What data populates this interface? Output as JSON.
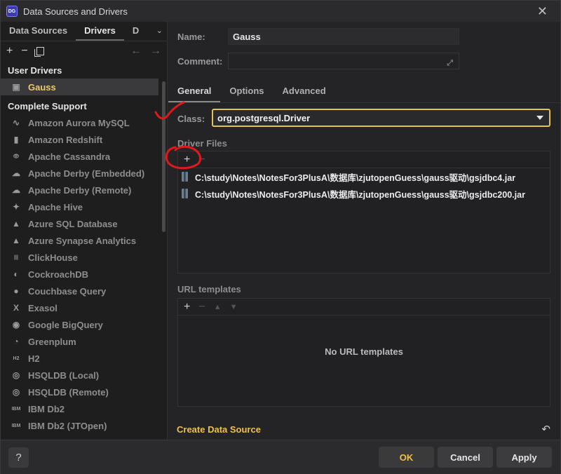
{
  "window": {
    "title": "Data Sources and Drivers",
    "app_icon_text": "DG"
  },
  "left": {
    "tabs": [
      "Data Sources",
      "Drivers",
      "D"
    ],
    "user_drivers_title": "User Drivers",
    "user_drivers": [
      {
        "name": "Gauss",
        "icon": "gauss-icon"
      }
    ],
    "complete_support_title": "Complete Support",
    "drivers": [
      {
        "name": "Amazon Aurora MySQL",
        "icon": "aurora-icon"
      },
      {
        "name": "Amazon Redshift",
        "icon": "redshift-icon"
      },
      {
        "name": "Apache Cassandra",
        "icon": "cassandra-icon"
      },
      {
        "name": "Apache Derby (Embedded)",
        "icon": "derby-icon"
      },
      {
        "name": "Apache Derby (Remote)",
        "icon": "derby-icon"
      },
      {
        "name": "Apache Hive",
        "icon": "hive-icon"
      },
      {
        "name": "Azure SQL Database",
        "icon": "azure-icon"
      },
      {
        "name": "Azure Synapse Analytics",
        "icon": "azure-icon"
      },
      {
        "name": "ClickHouse",
        "icon": "clickhouse-icon"
      },
      {
        "name": "CockroachDB",
        "icon": "cockroach-icon"
      },
      {
        "name": "Couchbase Query",
        "icon": "couchbase-icon"
      },
      {
        "name": "Exasol",
        "icon": "exasol-icon"
      },
      {
        "name": "Google BigQuery",
        "icon": "bigquery-icon"
      },
      {
        "name": "Greenplum",
        "icon": "greenplum-icon"
      },
      {
        "name": "H2",
        "icon": "h2-icon"
      },
      {
        "name": "HSQLDB (Local)",
        "icon": "hsqldb-icon"
      },
      {
        "name": "HSQLDB (Remote)",
        "icon": "hsqldb-icon"
      },
      {
        "name": "IBM Db2",
        "icon": "db2-icon"
      },
      {
        "name": "IBM Db2 (JTOpen)",
        "icon": "db2-icon"
      }
    ]
  },
  "form": {
    "name_label": "Name:",
    "name_value": "Gauss",
    "comment_label": "Comment:",
    "comment_value": "",
    "tabs": [
      "General",
      "Options",
      "Advanced"
    ],
    "class_label": "Class:",
    "class_value": "org.postgresql.Driver",
    "driver_files_title": "Driver Files",
    "driver_files": [
      "C:\\study\\Notes\\NotesFor3PlusA\\数据库\\zjutopenGuess\\gauss驱动\\gsjdbc4.jar",
      "C:\\study\\Notes\\NotesFor3PlusA\\数据库\\zjutopenGuess\\gauss驱动\\gsjdbc200.jar"
    ],
    "url_templates_title": "URL templates",
    "no_url_text": "No URL templates",
    "create_link": "Create Data Source"
  },
  "footer": {
    "help": "?",
    "ok": "OK",
    "cancel": "Cancel",
    "apply": "Apply"
  },
  "colors": {
    "accent": "#f0c14b",
    "annotation": "#e0191b"
  }
}
